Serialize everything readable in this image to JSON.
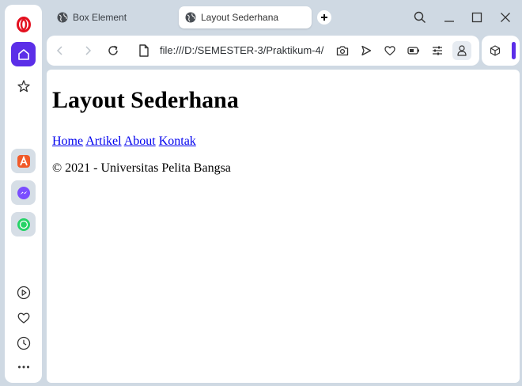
{
  "browser": {
    "tabs": [
      {
        "title": "Box Element",
        "active": false
      },
      {
        "title": "Layout Sederhana",
        "active": true
      }
    ],
    "url": "file:///D:/SEMESTER-3/Praktikum-4/",
    "sidebar_icons": [
      "opera-logo-icon",
      "home-icon",
      "bookmarks-icon",
      "aria-icon",
      "messenger-icon",
      "whatsapp-icon",
      "player-icon",
      "heart-icon",
      "history-icon",
      "more-icon"
    ],
    "accent_color": "#5b2ee8"
  },
  "page": {
    "heading": "Layout Sederhana",
    "nav_links": [
      "Home",
      "Artikel",
      "About",
      "Kontak"
    ],
    "footer": "© 2021 - Universitas Pelita Bangsa"
  }
}
